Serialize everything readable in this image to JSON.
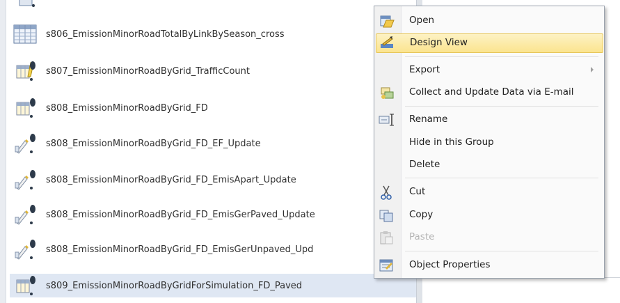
{
  "nav_pane": {
    "items": [
      {
        "label": "s806_EmissionMinorRoadTotalByLinkBySeason_cross",
        "icon": "table-icon"
      },
      {
        "label": "s807_EmissionMinorRoadByGrid_TrafficCount",
        "icon": "make-table-query-icon"
      },
      {
        "label": "s808_EmissionMinorRoadByGrid_FD",
        "icon": "make-table-query-icon"
      },
      {
        "label": "s808_EmissionMinorRoadByGrid_FD_EF_Update",
        "icon": "update-query-icon"
      },
      {
        "label": "s808_EmissionMinorRoadByGrid_FD_EmisApart_Update",
        "icon": "update-query-icon"
      },
      {
        "label": "s808_EmissionMinorRoadByGrid_FD_EmisGerPaved_Update",
        "icon": "update-query-icon"
      },
      {
        "label": "s808_EmissionMinorRoadByGrid_FD_EmisGerUnpaved_Upd",
        "icon": "update-query-icon"
      },
      {
        "label": "s809_EmissionMinorRoadByGridForSimulation_FD_Paved",
        "icon": "make-table-query-icon",
        "selected": true
      }
    ]
  },
  "context_menu": {
    "items": [
      {
        "label": "Open",
        "icon": "open-icon"
      },
      {
        "label": "Design View",
        "icon": "design-view-icon",
        "highlighted": true
      },
      {
        "label": "Export",
        "icon": "",
        "submenu": true
      },
      {
        "label": "Collect and Update Data via E-mail",
        "icon": "collect-data-icon"
      },
      {
        "label": "Rename",
        "icon": "rename-icon"
      },
      {
        "label": "Hide in this Group",
        "icon": ""
      },
      {
        "label": "Delete",
        "icon": ""
      },
      {
        "label": "Cut",
        "icon": "cut-icon"
      },
      {
        "label": "Copy",
        "icon": "copy-icon"
      },
      {
        "label": "Paste",
        "icon": "paste-icon",
        "disabled": true
      },
      {
        "label": "Object Properties",
        "icon": "properties-icon"
      }
    ]
  },
  "colors": {
    "highlight_start": "#fdf2c4",
    "highlight_end": "#fbe48f",
    "selected_row": "#dfe7f3",
    "exclamation": "#2d3a4a"
  }
}
